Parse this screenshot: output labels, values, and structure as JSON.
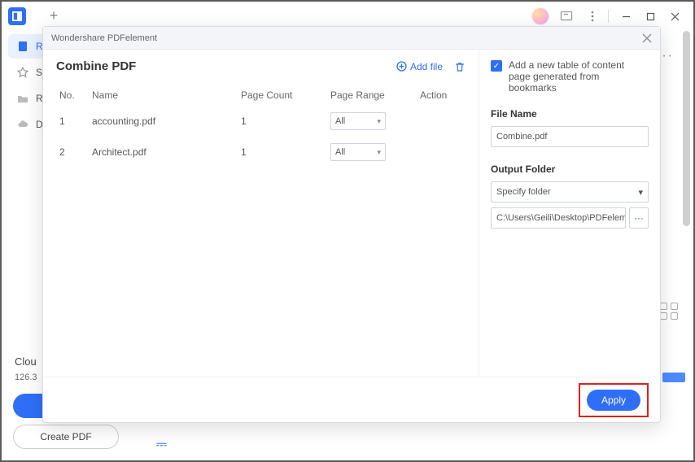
{
  "titlebar": {
    "plus": "+"
  },
  "sidebar": {
    "items": [
      {
        "label": "R"
      },
      {
        "label": "S"
      },
      {
        "label": "R"
      },
      {
        "label": "D"
      }
    ],
    "cloud_label": "Clou",
    "cloud_size": "126.3",
    "upgrade": "",
    "create_pdf": "Create PDF"
  },
  "dialog": {
    "window_title": "Wondershare PDFelement",
    "title": "Combine PDF",
    "add_file": "Add file",
    "table": {
      "headers": {
        "no": "No.",
        "name": "Name",
        "page_count": "Page Count",
        "page_range": "Page Range",
        "action": "Action"
      },
      "rows": [
        {
          "no": "1",
          "name": "accounting.pdf",
          "page_count": "1",
          "page_range": "All"
        },
        {
          "no": "2",
          "name": "Architect.pdf",
          "page_count": "1",
          "page_range": "All"
        }
      ]
    },
    "options": {
      "toc_label": "Add a new table of content page generated from bookmarks",
      "file_name_label": "File Name",
      "file_name_value": "Combine.pdf",
      "output_folder_label": "Output Folder",
      "specify_folder": "Specify folder",
      "output_path": "C:\\Users\\Geili\\Desktop\\PDFelement\\Co"
    },
    "apply": "Apply"
  }
}
